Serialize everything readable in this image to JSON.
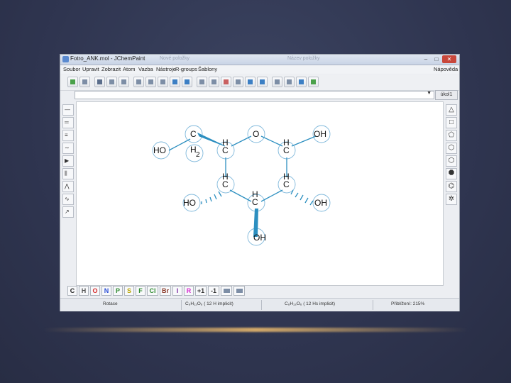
{
  "window": {
    "title": "Fotro_ANK.mol - JChemPaint",
    "ghost_title": "Nové položky",
    "ghost_name": "Název položky"
  },
  "menu": [
    "Soubor",
    "Upravit",
    "Zobrazit",
    "Atom",
    "Vazba",
    "Nástroje",
    "R-groups",
    "Šablony",
    "Nápověda"
  ],
  "combo": {
    "value": "",
    "button_label": "úkol1"
  },
  "molecule": {
    "labels": {
      "c_top": "C",
      "o_ring": "O",
      "oh_right_top": "OH",
      "ho_left": "HO",
      "h2": "H",
      "h2_sub": "2",
      "h_c1": "H",
      "c1": "C",
      "h_c2": "H",
      "c2": "C",
      "h_c3": "H",
      "c3": "C",
      "h_c4": "H",
      "c4": "C",
      "ho_left_bottom": "HO",
      "h_c5": "H",
      "c5": "C",
      "oh_right_bottom": "OH",
      "oh_bottom": "OH"
    }
  },
  "periodic_buttons": [
    {
      "label": "C",
      "color": "#222222"
    },
    {
      "label": "H",
      "color": "#555555"
    },
    {
      "label": "O",
      "color": "#d62b2b"
    },
    {
      "label": "N",
      "color": "#2b4fd6"
    },
    {
      "label": "P",
      "color": "#2e8a2e"
    },
    {
      "label": "S",
      "color": "#b8a400"
    },
    {
      "label": "F",
      "color": "#2e8a2e"
    },
    {
      "label": "Cl",
      "color": "#2e8a2e"
    },
    {
      "label": "Br",
      "color": "#8a3a2a"
    },
    {
      "label": "I",
      "color": "#7a2aa0"
    },
    {
      "label": "R",
      "color": "#d62bd0"
    },
    {
      "label": "+1",
      "color": "#333333"
    },
    {
      "label": "-1",
      "color": "#333333"
    }
  ],
  "status": {
    "left": "Rotace",
    "formula1": "C₆H₁₂O₆ ( 12 H implicit)",
    "formula2": "C₆H₁₂O₆ ( 12 Hs implicit)",
    "zoom": "Přiblížení: 215%"
  },
  "colors": {
    "accent_bond": "#2c8fc0",
    "selection_circle": "#7fb8db"
  }
}
